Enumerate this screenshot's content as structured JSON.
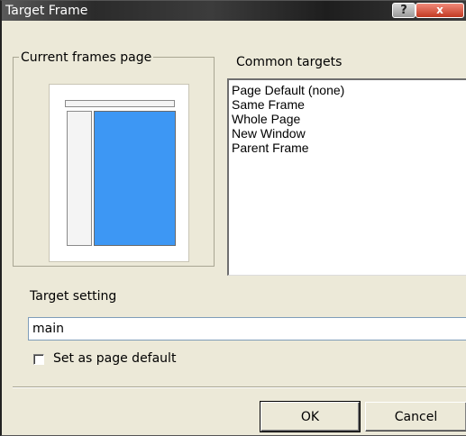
{
  "window": {
    "title": "Target Frame",
    "help_glyph": "?",
    "close_glyph": "x"
  },
  "preview": {
    "group_label": "Current frames page"
  },
  "targets": {
    "label": "Common targets",
    "items": [
      "Page Default (none)",
      "Same Frame",
      "Whole Page",
      "New Window",
      "Parent Frame"
    ]
  },
  "target_setting": {
    "label": "Target setting",
    "value": "main"
  },
  "page_default": {
    "label": "Set as page default",
    "checked": false
  },
  "buttons": {
    "ok": "OK",
    "cancel": "Cancel"
  }
}
